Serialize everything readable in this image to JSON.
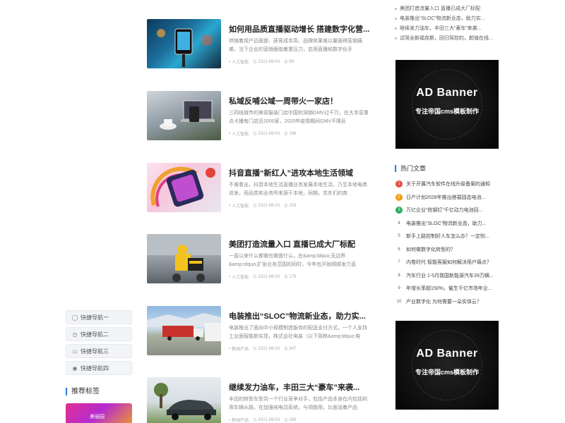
{
  "left_nav": {
    "items": [
      {
        "label": "快捷导航一",
        "icon": "chat-icon"
      },
      {
        "label": "快捷导航二",
        "icon": "clock-icon"
      },
      {
        "label": "快捷导航三",
        "icon": "chat-icon"
      },
      {
        "label": "快捷导航四",
        "icon": "location-icon"
      }
    ]
  },
  "recommend_tags": {
    "title": "推荐标签",
    "thumb_label": "美丽园"
  },
  "articles": [
    {
      "title": "如何用品质直播驱动增长 搭建数字化营...",
      "excerpt": "伴随着用户迈面提、获客成本高、品牌效果难以量面得营销痛难，当下企业的营销面临着重压力，启用直播和数字化手",
      "category": "人工智能",
      "date": "2021-08-03",
      "views": "99"
    },
    {
      "title": "私域反哺公域一周带火一家店！",
      "excerpt": "三四线城市的美容服装门店中国利润销GMV过千万，在大本营重点卡播有门店近2000家，2020年疫情期间GMV不降反",
      "category": "人工智能",
      "date": "2021-08-03",
      "views": "196"
    },
    {
      "title": "抖音直播“新红人”进攻本地生活领域",
      "excerpt": "不难看出，抖音本地生活直播业务发展本地生活，乃至本地电商进发，而品类和业务所来源于本地，同期，京东们的商",
      "category": "人工智能",
      "date": "2021-08-03",
      "views": "203"
    },
    {
      "title": "美团打造流量入口 直播已成大厂标配",
      "excerpt": "一直以来什么都做也做面什么，在&amp;ldquo;无边界&amp;rdquo;扩张业务范围的同时，今年也开始顺顺发力直",
      "category": "人工智能",
      "date": "2021-08-03",
      "views": "179"
    },
    {
      "title": "电装推出“SLOC”物流新业态，助力实...",
      "excerpt": "电装推出了面向中小规模制造服务的配送支付方式，一个人支持工业面智能新实现，株式会社电装（以下简称&amp;ldquo;电",
      "category": "新闻产品",
      "date": "2021-08-03",
      "views": "847"
    },
    {
      "title": "继续发力油车，丰田三大“豪车”来袭...",
      "excerpt": "丰田的转型车型另一个行业竞争对手，包括产品本身在内包括利用车辆从路，在加强纯电动系统，与领跑用，比面油着产品",
      "category": "新闻产品",
      "date": "2021-08-03",
      "views": "289"
    }
  ],
  "side_top_list": [
    "美团打造流量入口 直播已成大厂标配",
    "电装推出“SLOC”物流新业态，助力实...",
    "继续发力油车，丰田三大“豪车”来袭...",
    "试驾全新福克斯，回归驾控的，颜值在线..."
  ],
  "ads": [
    {
      "title": "AD Banner",
      "subtitle": "专注帝国cms模板制作"
    },
    {
      "title": "AD Banner",
      "subtitle": "专注帝国cms模板制作"
    }
  ],
  "hot": {
    "title": "热门文章",
    "items": [
      {
        "num": "1",
        "text": "关于开展汽车软件在线升级备案的通知"
      },
      {
        "num": "2",
        "text": "日产计划2028年推出搭载固态电池..."
      },
      {
        "num": "3",
        "text": "万亿企业“抢钢钉”千亿动力电池回..."
      },
      {
        "num": "4",
        "text": "电装推出“SLOC”物流新业态，助力..."
      },
      {
        "num": "5",
        "text": "新手上路控制好人车怎么办？一定别..."
      },
      {
        "num": "6",
        "text": "如何做数字化转型的？"
      },
      {
        "num": "7",
        "text": "内卷时代 智能客服如何解决用户痛点？"
      },
      {
        "num": "8",
        "text": "汽车行业 1-5月我国新能源汽车39万辆..."
      },
      {
        "num": "9",
        "text": "年增长率超150%，催生千亿市场年企..."
      },
      {
        "num": "10",
        "text": "产业数字化 为何需要一朵实体云？"
      }
    ]
  },
  "colors": {
    "accent": "#2b7cd3",
    "hot1": "#e74c3c",
    "hot2": "#f39c12",
    "hot3": "#27ae60"
  }
}
